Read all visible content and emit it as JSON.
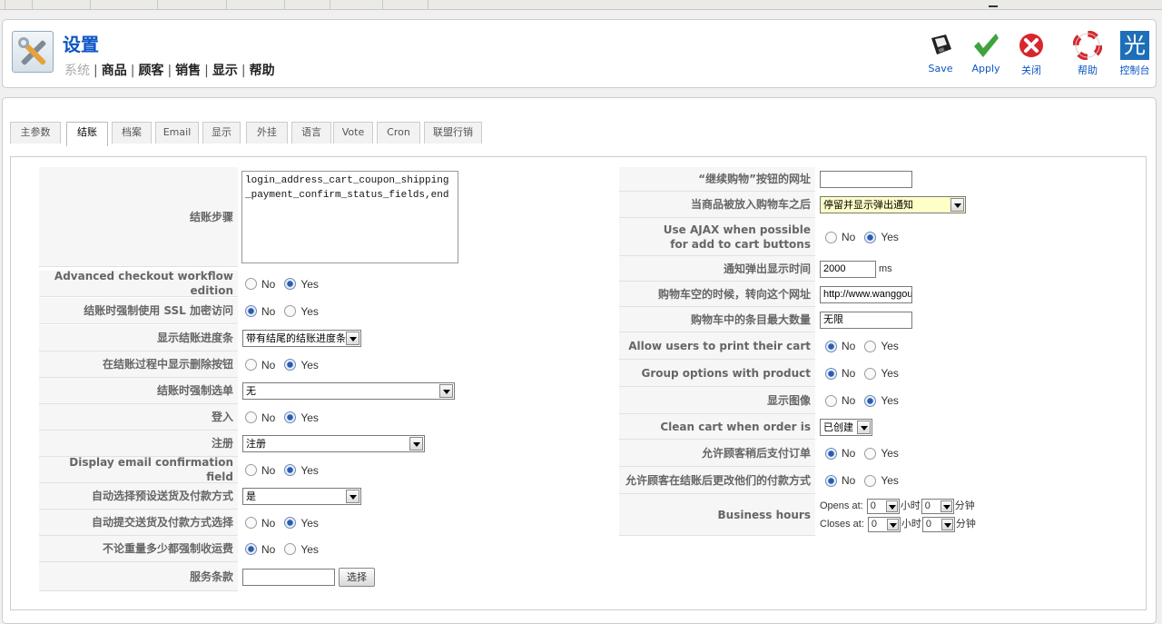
{
  "header": {
    "title": "设置",
    "submenu": {
      "current": "系统",
      "items": [
        "商品",
        "顾客",
        "销售",
        "显示",
        "帮助"
      ]
    }
  },
  "toolbar": [
    {
      "label": "Save",
      "icon": "floppy-save-icon"
    },
    {
      "label": "Apply",
      "icon": "check-icon"
    },
    {
      "label": "关闭",
      "icon": "close-circle-icon"
    },
    {
      "label": "帮助",
      "icon": "lifebuoy-help-icon"
    },
    {
      "label": "控制台",
      "icon": "dashboard-logo-icon",
      "glyph": "光"
    }
  ],
  "tabs": [
    "主参数",
    "结账",
    "档案",
    "Email",
    "显示",
    "外挂",
    "语言",
    "Vote",
    "Cron",
    "联盟行销"
  ],
  "active_tab": "结账",
  "left": {
    "checkout_steps": {
      "label": "结账步骤",
      "value": "login_address_cart_coupon_shipping_payment_confirm_status_fields,end"
    },
    "advanced_workflow": {
      "label": "Advanced checkout workflow edition",
      "no": "No",
      "yes": "Yes",
      "selected": "Yes"
    },
    "force_ssl": {
      "label": "结账时强制使用 SSL 加密访问",
      "no": "No",
      "yes": "Yes",
      "selected": "No"
    },
    "progress_bar": {
      "label": "显示结账进度条",
      "value": "带有结尾的结账进度条"
    },
    "show_remove": {
      "label": "在结账过程中显示删除按钮",
      "no": "No",
      "yes": "Yes",
      "selected": "Yes"
    },
    "force_menu": {
      "label": "结账时强制选单",
      "value": "无"
    },
    "login": {
      "label": "登入",
      "no": "No",
      "yes": "Yes",
      "selected": "Yes"
    },
    "register": {
      "label": "注册",
      "value": "注册"
    },
    "email_confirm": {
      "label": "Display email confirmation field",
      "no": "No",
      "yes": "Yes",
      "selected": "Yes"
    },
    "auto_select": {
      "label": "自动选择预设送货及付款方式",
      "value": "是"
    },
    "auto_submit": {
      "label": "自动提交送货及付款方式选择",
      "no": "No",
      "yes": "Yes",
      "selected": "Yes"
    },
    "force_shipping": {
      "label": "不论重量多少都强制收运费",
      "no": "No",
      "yes": "Yes",
      "selected": "No"
    },
    "terms": {
      "label": "服务条款",
      "value": "",
      "button": "选择"
    }
  },
  "right": {
    "continue_url": {
      "label": "“继续购物”按钮的网址",
      "value": ""
    },
    "after_add": {
      "label": "当商品被放入购物车之后",
      "value": "停留并显示弹出通知"
    },
    "ajax": {
      "label_line1": "Use AJAX when possible",
      "label_line2": "for add to cart buttons",
      "no": "No",
      "yes": "Yes",
      "selected": "Yes"
    },
    "popup_time": {
      "label": "通知弹出显示时间",
      "value": "2000",
      "unit": "ms"
    },
    "empty_redirect": {
      "label": "购物车空的时候，转向这个网址",
      "value": "http://www.wanggou"
    },
    "max_items": {
      "label": "购物车中的条目最大数量",
      "value": "无限"
    },
    "print_cart": {
      "label": "Allow users to print their cart",
      "no": "No",
      "yes": "Yes",
      "selected": "No"
    },
    "group_options": {
      "label": "Group options with product",
      "no": "No",
      "yes": "Yes",
      "selected": "No"
    },
    "show_image": {
      "label": "显示图像",
      "no": "No",
      "yes": "Yes",
      "selected": "Yes"
    },
    "clean_cart": {
      "label": "Clean cart when order is",
      "value": "已创建"
    },
    "pay_later": {
      "label": "允许顾客稍后支付订单",
      "no": "No",
      "yes": "Yes",
      "selected": "No"
    },
    "change_payment": {
      "label": "允许顾客在结账后更改他们的付款方式",
      "no": "No",
      "yes": "Yes",
      "selected": "No"
    },
    "business_hours": {
      "label": "Business hours",
      "opens": "Opens at:",
      "closes": "Closes at:",
      "open_hour": "0",
      "open_min": "0",
      "close_hour": "0",
      "close_min": "0",
      "hour_unit": "小时",
      "min_unit": "分钟"
    }
  }
}
